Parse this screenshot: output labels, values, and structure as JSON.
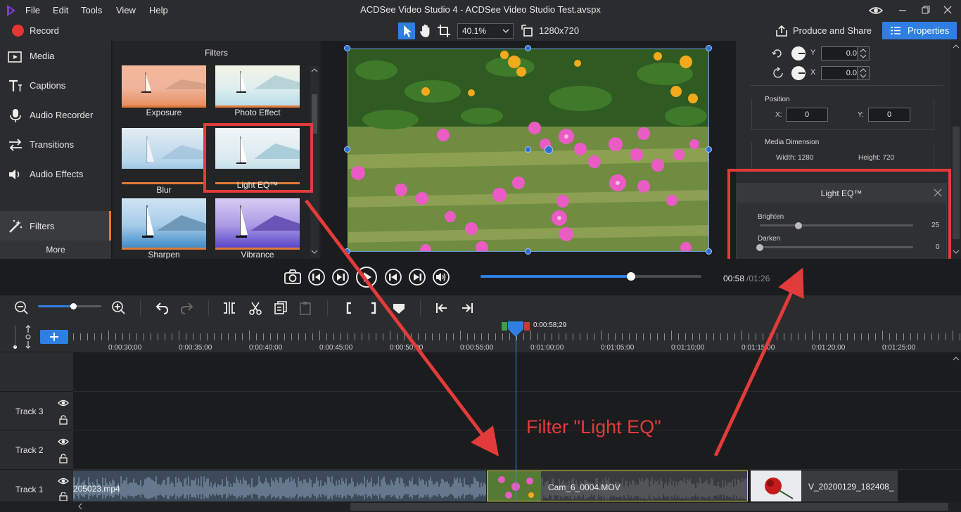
{
  "menu": [
    "File",
    "Edit",
    "Tools",
    "View",
    "Help"
  ],
  "window_title": "ACDSee Video Studio 4 - ACDSee Video Studio Test.avspx",
  "toolbar": {
    "record_label": "Record",
    "zoom_value": "40.1%",
    "resolution": "1280x720",
    "produce_label": "Produce and Share",
    "properties_label": "Properties"
  },
  "nav": {
    "items": [
      "Media",
      "Captions",
      "Audio Recorder",
      "Transitions",
      "Audio Effects",
      "Filters"
    ],
    "more_label": "More"
  },
  "filters": {
    "title": "Filters",
    "items": [
      "Exposure",
      "Photo Effect",
      "Blur",
      "Light EQ™",
      "Sharpen",
      "Vibrance"
    ]
  },
  "properties": {
    "rot_y_label": "Y",
    "rot_y_value": "0.0",
    "rot_x_label": "X",
    "rot_x_value": "0.0",
    "position_title": "Position",
    "pos_x_label": "X:",
    "pos_x_value": "0",
    "pos_y_label": "Y:",
    "pos_y_value": "0",
    "dimension_title": "Media Dimension",
    "width_text": "Width: 1280",
    "height_text": "Height: 720"
  },
  "light_eq": {
    "title": "Light EQ™",
    "brighten_label": "Brighten",
    "brighten_value": "25",
    "darken_label": "Darken",
    "darken_value": "0"
  },
  "playback": {
    "time_current": "00:58",
    "time_total": "/01:26",
    "progress_fraction": 0.68
  },
  "timeline": {
    "playhead_time": "0:00:58;29",
    "ticks": [
      "0:00:30;00",
      "0:00:35;00",
      "0:00:40;00",
      "0:00:45;00",
      "0:00:50;00",
      "0:00:55;00",
      "0:01:00;00",
      "0:01:05;00",
      "0:01:10;00",
      "0:01:15;00",
      "0:01:20;00",
      "0:01:25;00"
    ],
    "tracks": [
      "Track 3",
      "Track 2",
      "Track 1"
    ],
    "clips": {
      "clip1": "205023.mp4",
      "clip2": "Cam_6_0004.MOV",
      "clip3": "V_20200129_182408_"
    }
  },
  "annotation": {
    "text": "Filter \"Light EQ\"",
    "color": "#e23b3b"
  },
  "colors": {
    "accent": "#2f7fe2",
    "filter_bar": "#e07a3a",
    "record": "#e53535"
  }
}
